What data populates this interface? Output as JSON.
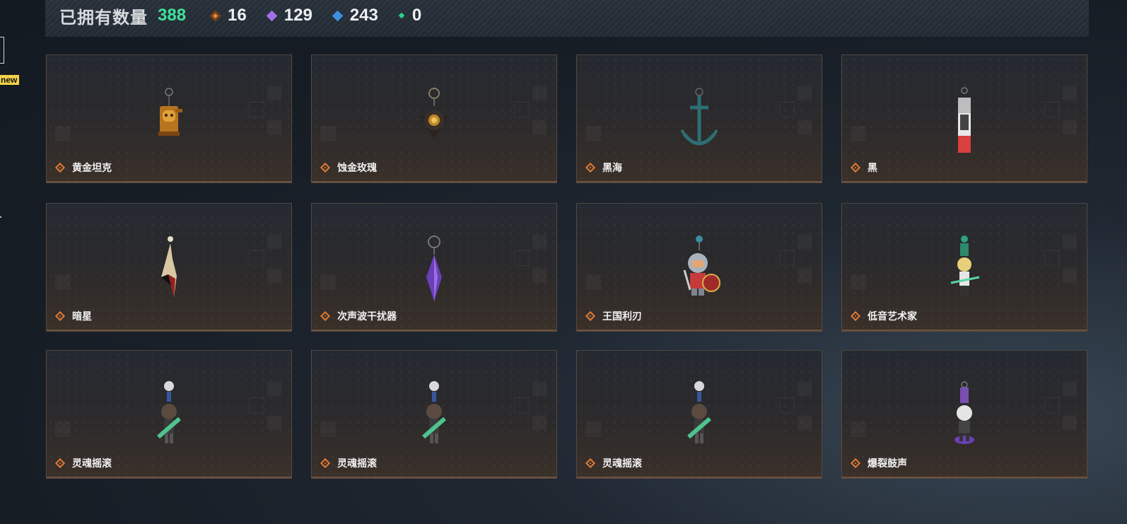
{
  "side": {
    "badge": "new"
  },
  "header": {
    "owned_label": "已拥有数量",
    "owned_value": "388",
    "rarities": [
      {
        "icon": "orange-gem-icon",
        "color": "#e88a3c",
        "value": "16"
      },
      {
        "icon": "purple-gem-icon",
        "color": "#a36fe8",
        "value": "129"
      },
      {
        "icon": "blue-gem-icon",
        "color": "#3c8fe0",
        "value": "243"
      },
      {
        "icon": "green-gem-icon",
        "color": "#2fd38c",
        "value": "0"
      }
    ]
  },
  "items": [
    {
      "name": "黄金坦克",
      "icon": "golden-tank-charm-icon",
      "rarity_color": "#e07a35"
    },
    {
      "name": "蚀金玫瑰",
      "icon": "rose-charm-icon",
      "rarity_color": "#e07a35"
    },
    {
      "name": "黑海",
      "icon": "anchor-charm-icon",
      "rarity_color": "#e07a35"
    },
    {
      "name": "黑",
      "icon": "banner-charm-icon",
      "rarity_color": "#e07a35"
    },
    {
      "name": "暗星",
      "icon": "feather-charm-icon",
      "rarity_color": "#e07a35"
    },
    {
      "name": "次声波干扰器",
      "icon": "crystal-charm-icon",
      "rarity_color": "#e07a35"
    },
    {
      "name": "王国利刃",
      "icon": "knight-charm-icon",
      "rarity_color": "#e07a35"
    },
    {
      "name": "低音艺术家",
      "icon": "bass-artist-charm-icon",
      "rarity_color": "#e07a35"
    },
    {
      "name": "灵魂摇滚",
      "icon": "guitarist-charm-icon",
      "rarity_color": "#e07a35"
    },
    {
      "name": "灵魂摇滚",
      "icon": "guitarist-charm-icon",
      "rarity_color": "#e07a35"
    },
    {
      "name": "灵魂摇滚",
      "icon": "guitarist-charm-icon",
      "rarity_color": "#e07a35"
    },
    {
      "name": "爆裂鼓声",
      "icon": "drummer-charm-icon",
      "rarity_color": "#e07a35"
    }
  ]
}
